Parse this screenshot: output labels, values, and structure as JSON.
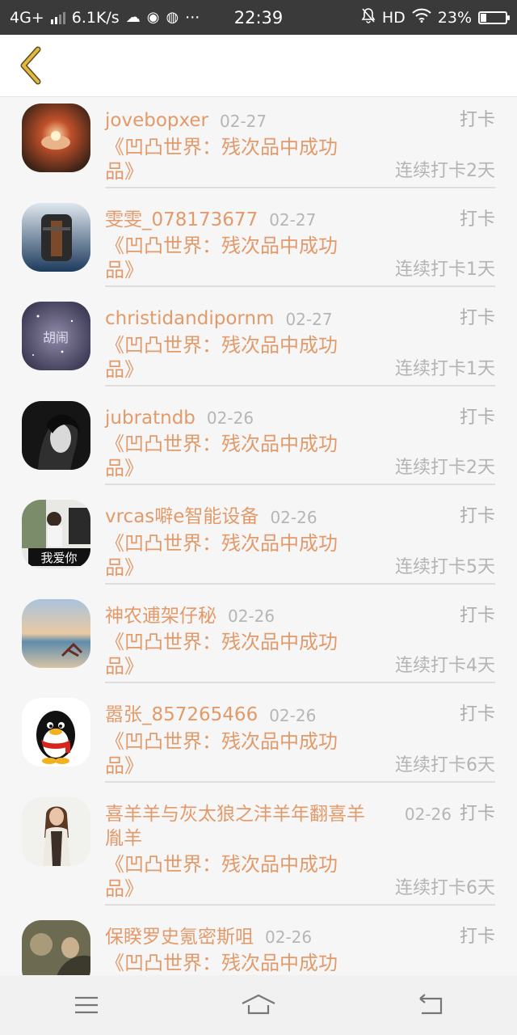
{
  "status_bar": {
    "network": "4G+",
    "speed": "6.1K/s",
    "more": "···",
    "time": "22:39",
    "hd": "HD",
    "battery_percent": "23%",
    "battery_level": 0.23,
    "icons": [
      "cloud-icon",
      "chat-icon",
      "browser-icon",
      "mute-bell-icon",
      "wifi-icon",
      "battery-icon"
    ]
  },
  "header": {
    "back_icon": "chevron-left-icon",
    "accent_color": "#e3a12a"
  },
  "list": {
    "text_color": "#e39a6a",
    "items": [
      {
        "name": "jovebopxer",
        "date": "02-27",
        "action": "打卡",
        "book": "《凹凸世界：残次品中成功品》",
        "streak": "连续打卡2天"
      },
      {
        "name": "雯雯_078173677",
        "date": "02-27",
        "action": "打卡",
        "book": "《凹凸世界：残次品中成功品》",
        "streak": "连续打卡1天"
      },
      {
        "name": "christidandipornm",
        "date": "02-27",
        "action": "打卡",
        "book": "《凹凸世界：残次品中成功品》",
        "streak": "连续打卡1天"
      },
      {
        "name": "jubratndb",
        "date": "02-26",
        "action": "打卡",
        "book": "《凹凸世界：残次品中成功品》",
        "streak": "连续打卡2天"
      },
      {
        "name": "vrcas噼e智能设备",
        "date": "02-26",
        "action": "打卡",
        "book": "《凹凸世界：残次品中成功品》",
        "streak": "连续打卡5天"
      },
      {
        "name": "神农逋架仔秘",
        "date": "02-26",
        "action": "打卡",
        "book": "《凹凸世界：残次品中成功品》",
        "streak": "连续打卡4天"
      },
      {
        "name": "嚣张_857265466",
        "date": "02-26",
        "action": "打卡",
        "book": "《凹凸世界：残次品中成功品》",
        "streak": "连续打卡6天"
      },
      {
        "name": "喜羊羊与灰太狼之沣羊年翻喜羊胤羊",
        "date": "02-26",
        "action": "打卡",
        "book": "《凹凸世界：残次品中成功品》",
        "streak": "连续打卡6天"
      },
      {
        "name": "保睽罗史氪密斯咀",
        "date": "02-26",
        "action": "打卡",
        "book": "《凹凸世界：残次品中成功品》",
        "streak": ""
      }
    ]
  },
  "avatar_text": {
    "item5": "我爱你",
    "item3": "胡闹"
  },
  "system_nav": {
    "icons": [
      "menu-icon",
      "home-icon",
      "back-arrow-icon"
    ]
  }
}
